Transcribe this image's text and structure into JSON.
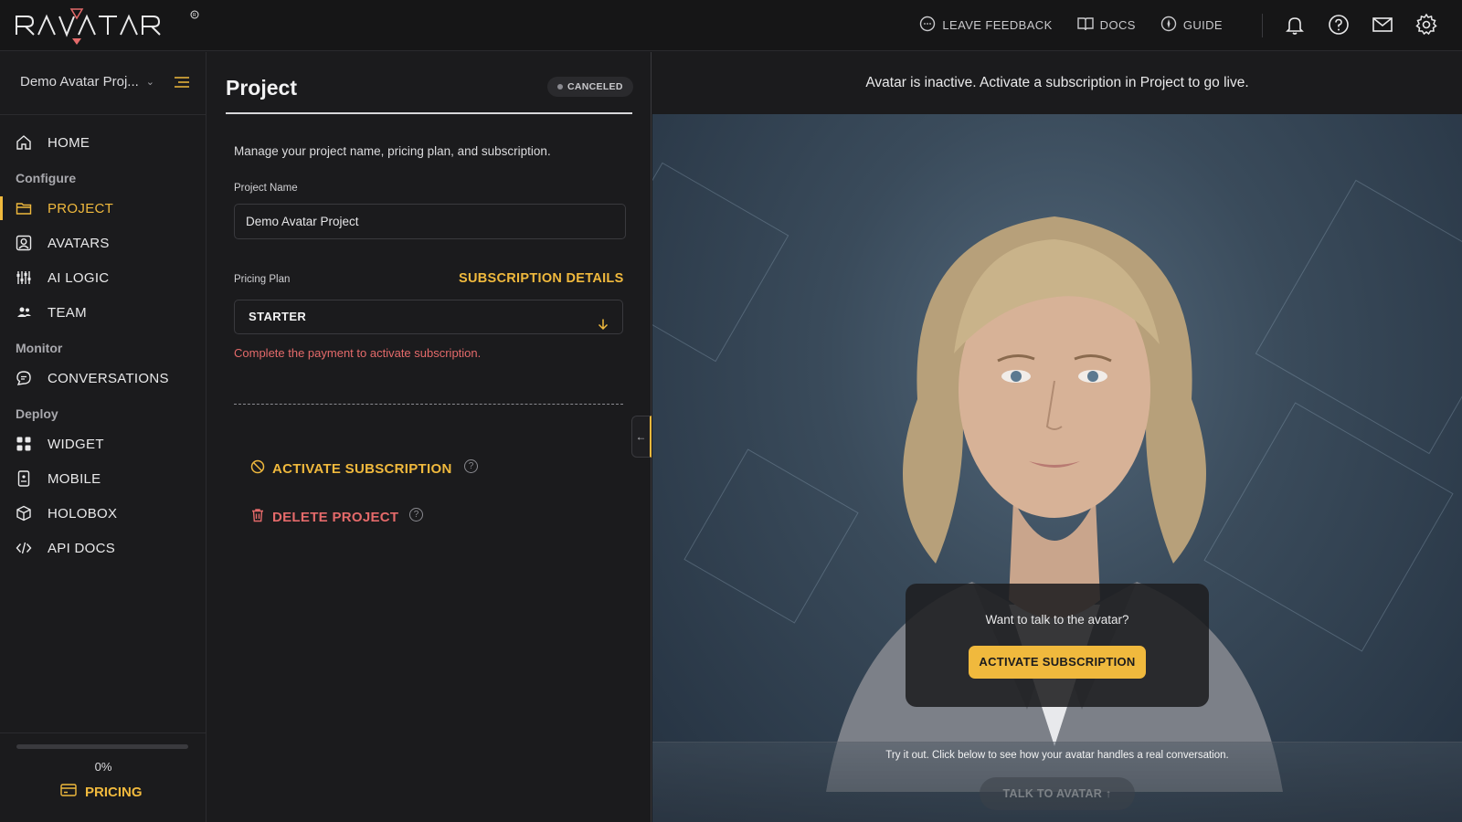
{
  "brand": {
    "name": "RAVATAR",
    "accent": "#f0b93d",
    "danger": "#e46a6a"
  },
  "topbar": {
    "links": [
      {
        "label": "LEAVE FEEDBACK",
        "icon": "feedback-icon"
      },
      {
        "label": "DOCS",
        "icon": "book-icon"
      },
      {
        "label": "GUIDE",
        "icon": "compass-icon"
      }
    ],
    "icons": [
      "bell-icon",
      "help-icon",
      "mail-icon",
      "gear-icon"
    ]
  },
  "sidebar": {
    "project_name": "Demo Avatar Proj...",
    "home": {
      "label": "HOME",
      "icon": "home-icon"
    },
    "sections": [
      {
        "title": "Configure",
        "items": [
          {
            "label": "PROJECT",
            "icon": "folder-icon",
            "active": true
          },
          {
            "label": "AVATARS",
            "icon": "avatar-icon"
          },
          {
            "label": "AI LOGIC",
            "icon": "sliders-icon"
          },
          {
            "label": "TEAM",
            "icon": "team-icon"
          }
        ]
      },
      {
        "title": "Monitor",
        "items": [
          {
            "label": "CONVERSATIONS",
            "icon": "chat-icon"
          }
        ]
      },
      {
        "title": "Deploy",
        "items": [
          {
            "label": "WIDGET",
            "icon": "grid-icon"
          },
          {
            "label": "MOBILE",
            "icon": "mobile-icon"
          },
          {
            "label": "HOLOBOX",
            "icon": "cube-icon"
          },
          {
            "label": "API DOCS",
            "icon": "code-icon"
          }
        ]
      }
    ],
    "progress": {
      "value": 0,
      "label": "0%"
    },
    "pricing_label": "PRICING"
  },
  "panel": {
    "title": "Project",
    "status": "CANCELED",
    "description": "Manage your project name, pricing plan, and subscription.",
    "project_name_label": "Project Name",
    "project_name_value": "Demo Avatar Project",
    "pricing_plan_label": "Pricing Plan",
    "subscription_details_label": "SUBSCRIPTION DETAILS",
    "plan_value": "STARTER",
    "payment_warning": "Complete the payment to activate subscription.",
    "activate_label": "ACTIVATE SUBSCRIPTION",
    "delete_label": "DELETE PROJECT"
  },
  "preview": {
    "banner": "Avatar is inactive. Activate a subscription in Project to go live.",
    "cta_question": "Want to talk to the avatar?",
    "cta_button": "ACTIVATE SUBSCRIPTION",
    "footer_text": "Try it out. Click below to see how your avatar handles a real conversation.",
    "talk_button": "TALK TO AVATAR ↑"
  }
}
